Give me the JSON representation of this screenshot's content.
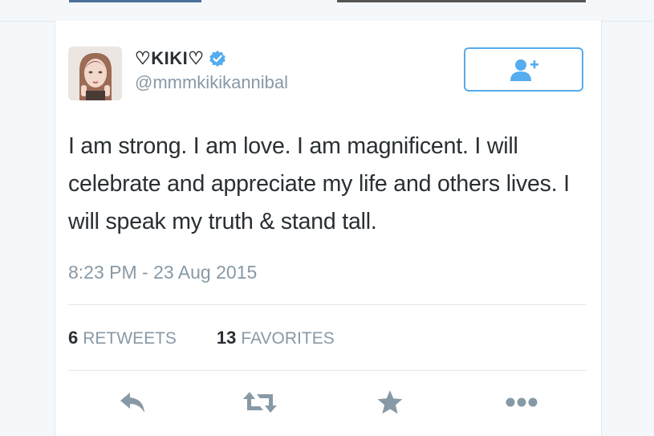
{
  "tweet": {
    "display_name": "♡KIKI♡",
    "handle": "@mmmkikikannibal",
    "text": "I am strong. I am love. I am magnificent. I will celebrate and appreciate my life and others lives. I will speak my truth & stand tall.",
    "timestamp": "8:23 PM - 23 Aug 2015",
    "verified_icon": "verified-badge-icon",
    "follow_icon": "follow-user-plus-icon"
  },
  "stats": {
    "retweets_count": "6",
    "retweets_label": "RETWEETS",
    "favorites_count": "13",
    "favorites_label": "FAVORITES"
  },
  "actions": [
    "reply-icon",
    "retweet-icon",
    "favorite-star-icon",
    "more-icon"
  ],
  "colors": {
    "accent": "#55acee",
    "text": "#292f33",
    "muted": "#8899a6",
    "border": "#e1e8ed"
  }
}
